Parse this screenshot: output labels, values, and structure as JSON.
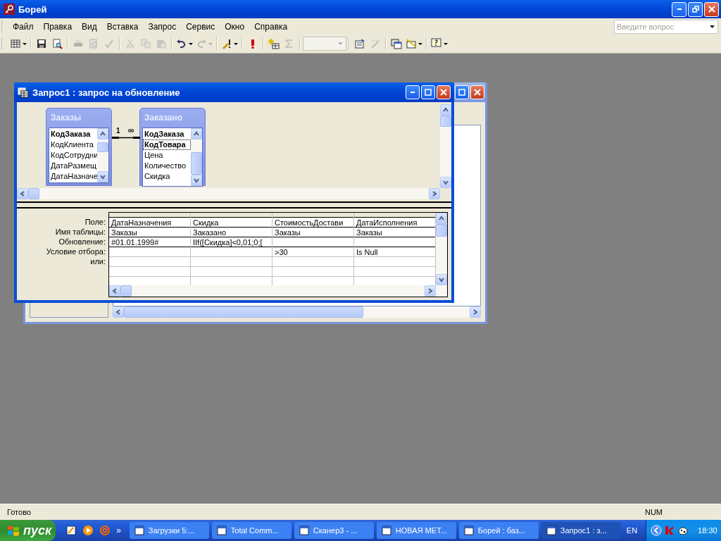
{
  "window": {
    "title": "Борей"
  },
  "menu": [
    "Файл",
    "Правка",
    "Вид",
    "Вставка",
    "Запрос",
    "Сервис",
    "Окно",
    "Справка"
  ],
  "help_search": {
    "placeholder": "Введите вопрос"
  },
  "toolbar": [
    [
      {
        "kind": "split",
        "disabled": false
      }
    ],
    [
      {
        "kind": "button",
        "disabled": false
      },
      {
        "kind": "button",
        "disabled": false
      }
    ],
    [
      {
        "kind": "button",
        "disabled": true
      },
      {
        "kind": "button",
        "disabled": true
      },
      {
        "kind": "button",
        "disabled": true
      }
    ],
    [
      {
        "kind": "button",
        "disabled": true
      },
      {
        "kind": "button",
        "disabled": true
      },
      {
        "kind": "button",
        "disabled": true
      }
    ],
    [
      {
        "kind": "split",
        "disabled": false
      },
      {
        "kind": "split",
        "disabled": true
      }
    ],
    [
      {
        "kind": "split",
        "disabled": false
      }
    ],
    [
      {
        "kind": "button",
        "disabled": false
      }
    ],
    [
      {
        "kind": "button",
        "disabled": false
      },
      {
        "kind": "button",
        "disabled": true
      }
    ],
    [
      {
        "kind": "combo",
        "disabled": true
      }
    ],
    [
      {
        "kind": "button",
        "disabled": false
      },
      {
        "kind": "button",
        "disabled": true
      }
    ],
    [
      {
        "kind": "button",
        "disabled": false
      },
      {
        "kind": "split",
        "disabled": false
      }
    ],
    [
      {
        "kind": "split",
        "disabled": false
      }
    ]
  ],
  "query_window": {
    "title": "Запрос1 : запрос на обновление",
    "tables": [
      {
        "name": "Заказы",
        "fields": [
          {
            "name": "КодЗаказа",
            "key": true,
            "selected": false
          },
          {
            "name": "КодКлиента",
            "key": false,
            "selected": false
          },
          {
            "name": "КодСотрудни",
            "key": false,
            "selected": false
          },
          {
            "name": "ДатаРазмещ",
            "key": false,
            "selected": false
          },
          {
            "name": "ДатаНазначе",
            "key": false,
            "selected": false
          }
        ]
      },
      {
        "name": "Заказано",
        "fields": [
          {
            "name": "КодЗаказа",
            "key": true,
            "selected": false
          },
          {
            "name": "КодТовара",
            "key": true,
            "selected": true
          },
          {
            "name": "Цена",
            "key": false,
            "selected": false
          },
          {
            "name": "Количество",
            "key": false,
            "selected": false
          },
          {
            "name": "Скидка",
            "key": false,
            "selected": false
          }
        ]
      }
    ],
    "relationship": {
      "one": "1",
      "many": "∞"
    },
    "row_labels": [
      "Поле:",
      "Имя таблицы:",
      "Обновление:",
      "Условие отбора:",
      "или:"
    ],
    "columns": [
      {
        "cells": [
          "ДатаНазначения",
          "Заказы",
          "#01.01.1999#",
          "",
          ""
        ]
      },
      {
        "cells": [
          "Скидка",
          "Заказано",
          "IIf([Скидка]<0,01;0;[",
          "",
          ""
        ]
      },
      {
        "cells": [
          "СтоимостьДостави",
          "Заказы",
          "",
          ">30",
          ""
        ]
      },
      {
        "cells": [
          "ДатаИсполнения",
          "Заказы",
          "",
          "Is Null",
          ""
        ]
      }
    ]
  },
  "status_bar": {
    "text": "Готово",
    "indicator": "NUM"
  },
  "taskbar": {
    "start": "пуск",
    "more": "»",
    "tasks": [
      {
        "label": "Загрузки 5:...",
        "selected": false
      },
      {
        "label": "Total Comm...",
        "selected": false
      },
      {
        "label": "Сканер3 - ...",
        "selected": false
      },
      {
        "label": "НОВАЯ МЕТ...",
        "selected": false
      },
      {
        "label": "Борей : баз...",
        "selected": false
      },
      {
        "label": "Запрос1 : з...",
        "selected": true
      }
    ],
    "language": "EN",
    "time": "18:30"
  }
}
